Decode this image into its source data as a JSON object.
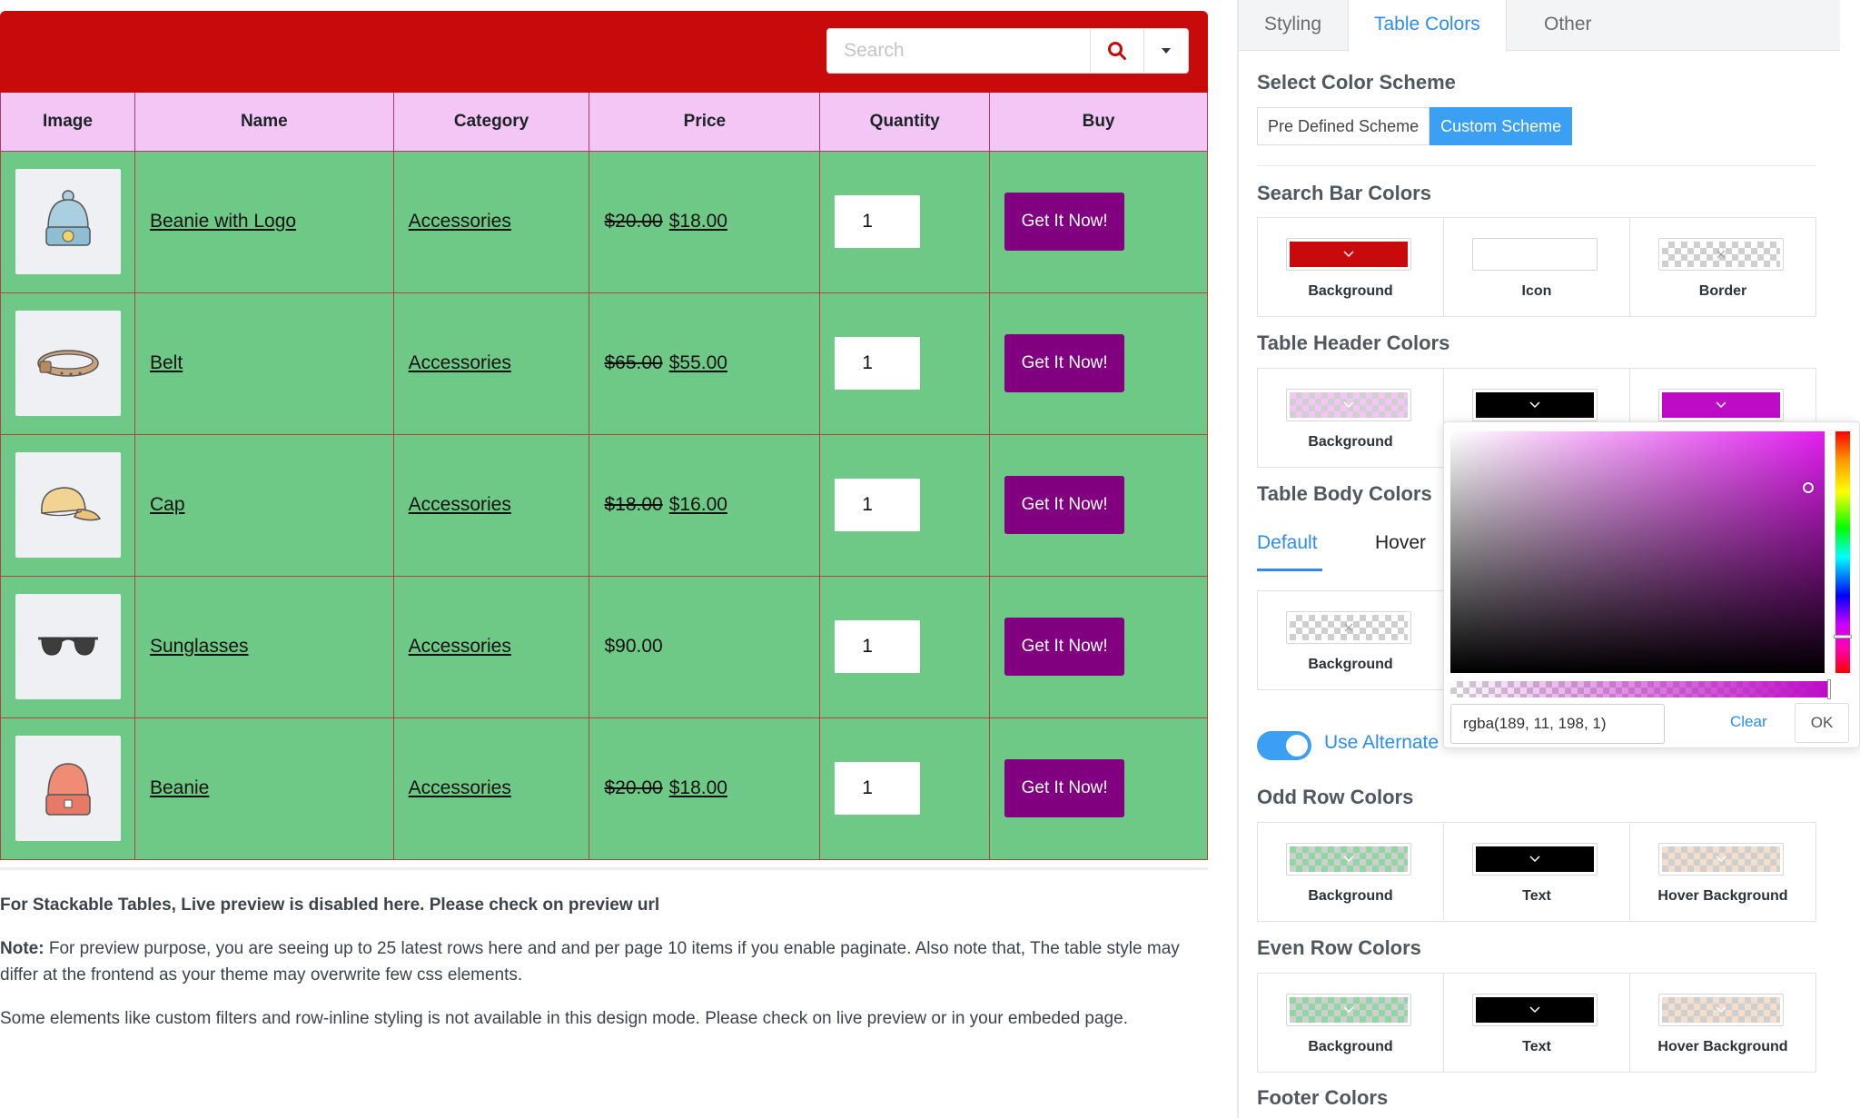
{
  "search": {
    "placeholder": "Search"
  },
  "table": {
    "headers": [
      "Image",
      "Name",
      "Category",
      "Price",
      "Quantity",
      "Buy"
    ],
    "rows": [
      {
        "image": "beanie-with-logo",
        "name": "Beanie with Logo",
        "category": "Accessories",
        "old_price": "$20.00",
        "price": "$18.00",
        "quantity": "1",
        "buy_label": "Get It Now!"
      },
      {
        "image": "belt",
        "name": "Belt",
        "category": "Accessories",
        "old_price": "$65.00",
        "price": "$55.00",
        "quantity": "1",
        "buy_label": "Get It Now!"
      },
      {
        "image": "cap",
        "name": "Cap",
        "category": "Accessories",
        "old_price": "$18.00",
        "price": "$16.00",
        "quantity": "1",
        "buy_label": "Get It Now!"
      },
      {
        "image": "sunglasses",
        "name": "Sunglasses",
        "category": "Accessories",
        "old_price": "",
        "price": "$90.00",
        "quantity": "1",
        "buy_label": "Get It Now!"
      },
      {
        "image": "beanie",
        "name": "Beanie",
        "category": "Accessories",
        "old_price": "$20.00",
        "price": "$18.00",
        "quantity": "1",
        "buy_label": "Get It Now!"
      }
    ]
  },
  "notes": {
    "line1": "For Stackable Tables, Live preview is disabled here. Please check on preview url",
    "note_label": "Note:",
    "line2": " For preview purpose, you are seeing up to 25 latest rows here and and per page 10 items if you enable paginate. Also note that, The table style may differ at the frontend as your theme may overwrite few css elements.",
    "line3": "Some elements like custom filters and row-inline styling is not available in this design mode. Please check on live preview or in your embeded page."
  },
  "panel": {
    "tabs": [
      "Styling",
      "Table Colors",
      "Other"
    ],
    "active_tab": "Table Colors",
    "select_scheme_title": "Select Color Scheme",
    "scheme_options": [
      "Pre Defined Scheme",
      "Custom Scheme"
    ],
    "active_scheme": "Custom Scheme",
    "search_bar_title": "Search Bar Colors",
    "search_bar_labels": [
      "Background",
      "Icon",
      "Border"
    ],
    "header_title": "Table Header Colors",
    "header_labels": [
      "Background",
      "",
      ""
    ],
    "body_title": "Table Body Colors",
    "body_tabs": [
      "Default",
      "Hover"
    ],
    "body_labels": [
      "Background"
    ],
    "alternate_label": "Use Alternate",
    "odd_title": "Odd Row Colors",
    "odd_labels": [
      "Background",
      "Text",
      "Hover Background"
    ],
    "even_title": "Even Row Colors",
    "even_labels": [
      "Background",
      "Text",
      "Hover Background"
    ],
    "footer_title": "Footer Colors"
  },
  "colors": {
    "search_bg": "#c90a0a",
    "header_bg": "#f3c6f6",
    "row_bg": "#6ec986",
    "buy_bg": "#800080",
    "accent": "#2c8cf0",
    "header_text_color": "#000000",
    "header_border_color": "#bd0bc6",
    "odd_text": "#000000",
    "even_text": "#000000"
  },
  "picker": {
    "value": "rgba(189, 11, 198, 1)",
    "clear_label": "Clear",
    "ok_label": "OK"
  }
}
